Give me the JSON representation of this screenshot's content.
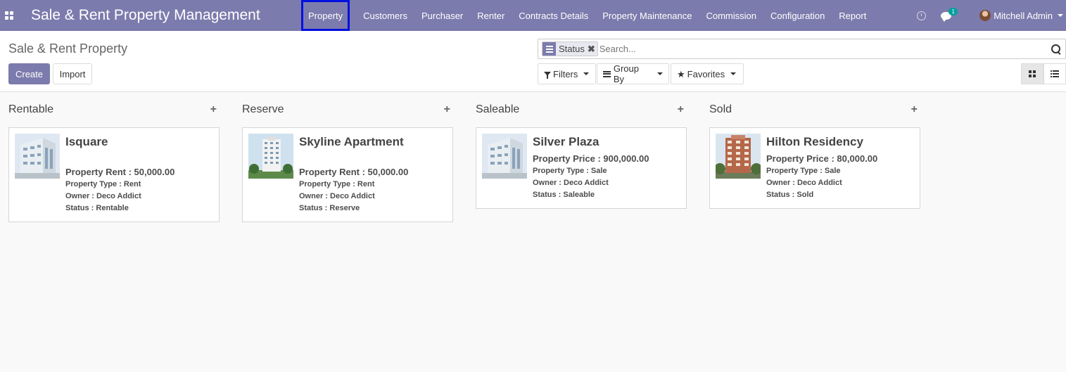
{
  "navbar": {
    "brand": "Sale & Rent Property Management",
    "menu": [
      "Property",
      "Customers",
      "Purchaser",
      "Renter",
      "Contracts Details",
      "Property Maintenance",
      "Commission",
      "Configuration",
      "Report"
    ],
    "chat_badge": "1",
    "user_name": "Mitchell Admin"
  },
  "control": {
    "title": "Sale & Rent Property",
    "create_label": "Create",
    "import_label": "Import",
    "facet_label": "Status",
    "search_placeholder": "Search...",
    "filters_label": "Filters",
    "group_by_label": "Group By",
    "favorites_label": "Favorites"
  },
  "columns": [
    {
      "title": "Rentable",
      "card": {
        "name": "Isquare",
        "price": "Property Rent : 50,000.00",
        "type": "Property Type : Rent",
        "owner": "Owner : Deco Addict",
        "status": "Status : Rentable"
      }
    },
    {
      "title": "Reserve",
      "card": {
        "name": "Skyline Apartment",
        "price": "Property Rent : 50,000.00",
        "type": "Property Type : Rent",
        "owner": "Owner : Deco Addict",
        "status": "Status : Reserve"
      }
    },
    {
      "title": "Saleable",
      "card": {
        "name": "Silver Plaza",
        "price": "Property Price : 900,000.00",
        "type": "Property Type : Sale",
        "owner": "Owner : Deco Addict",
        "status": "Status : Saleable"
      }
    },
    {
      "title": "Sold",
      "card": {
        "name": "Hilton Residency",
        "price": "Property Price : 80,000.00",
        "type": "Property Type : Sale",
        "owner": "Owner : Deco Addict",
        "status": "Status : Sold"
      }
    }
  ],
  "colors": {
    "brand": "#7c7bad",
    "active_outline": "#0010e0",
    "badge": "#00a09d"
  }
}
